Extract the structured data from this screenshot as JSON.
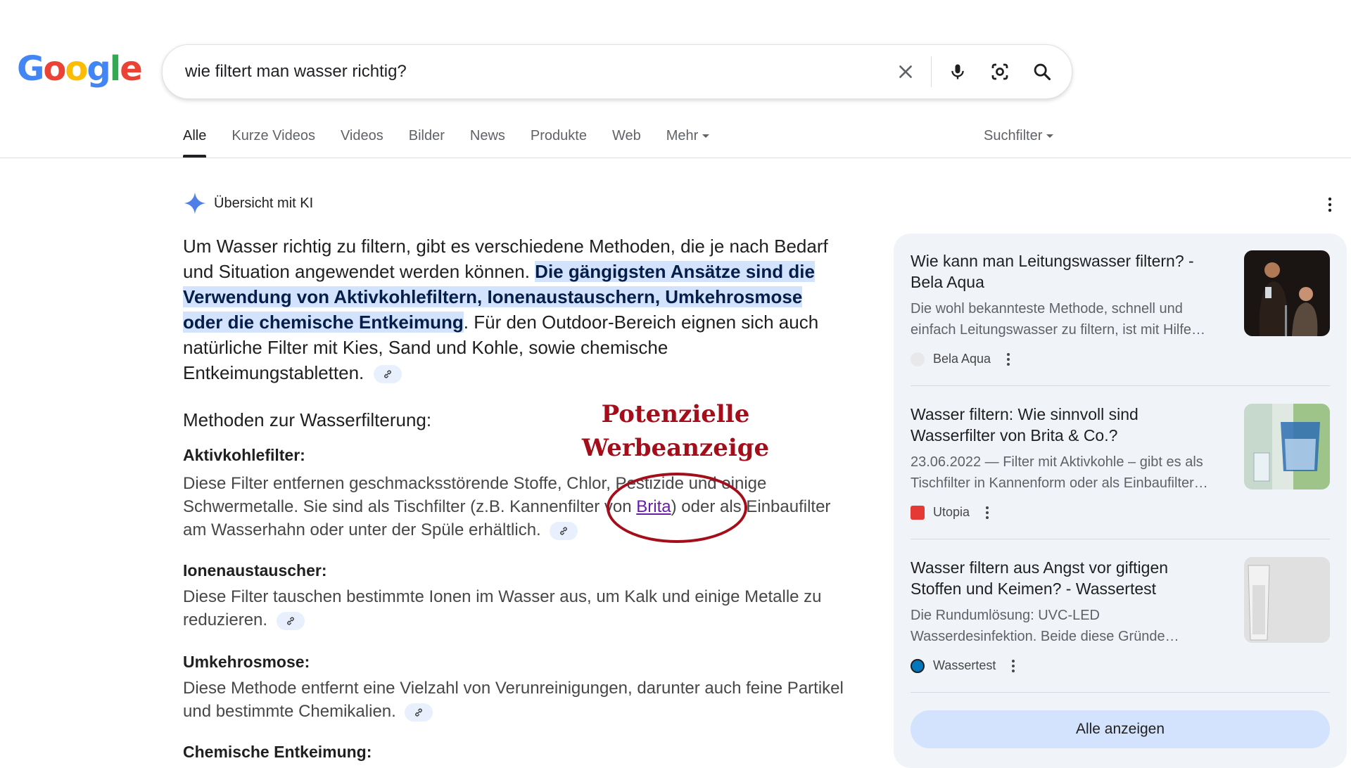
{
  "logo": {
    "letters": [
      "G",
      "o",
      "o",
      "g",
      "l",
      "e"
    ],
    "colors": [
      "#4285F4",
      "#EA4335",
      "#FBBC05",
      "#4285F4",
      "#34A853",
      "#EA4335"
    ]
  },
  "search": {
    "query": "wie filtert man wasser richtig?",
    "icons": [
      "close-icon",
      "mic-icon",
      "lens-icon",
      "search-icon"
    ]
  },
  "tabs": [
    "Alle",
    "Kurze Videos",
    "Videos",
    "Bilder",
    "News",
    "Produkte",
    "Web",
    "Mehr"
  ],
  "suchfilter": "Suchfilter",
  "ai": {
    "title": "Übersicht mit KI",
    "intro_pre": "Um Wasser richtig zu filtern, gibt es verschiedene Methoden, die je nach Bedarf und Situation angewendet werden können. ",
    "intro_highlight": "Die gängigsten Ansätze sind die Verwendung von Aktivkohlefiltern, Ionenaustauschern, Umkehrosmose oder die chemische Entkeimung",
    "intro_post": ". Für den Outdoor-Bereich eignen sich auch natürliche Filter mit Kies, Sand und Kohle, sowie chemische Entkeimungstabletten.",
    "section_heading": "Methoden zur Wasserfilterung:",
    "items": [
      {
        "heading": "Aktivkohlefilter:",
        "text_pre": "Diese Filter entfernen geschmacksstörende Stoffe, Chlor, Pestizide und einige Schwermetalle. Sie sind als Tischfilter (z.B. Kannenfilter von ",
        "link": "Brita",
        "text_post": ") oder als Einbaufilter am Wasserhahn oder unter der Spüle erhältlich."
      },
      {
        "heading": "Ionenaustauscher:",
        "text": "Diese Filter tauschen bestimmte Ionen im Wasser aus, um Kalk und einige Metalle zu reduzieren."
      },
      {
        "heading": "Umkehrosmose:",
        "text": "Diese Methode entfernt eine Vielzahl von Verunreinigungen, darunter auch feine Partikel und bestimmte Chemikalien."
      },
      {
        "heading": "Chemische Entkeimung:"
      }
    ]
  },
  "annotation": {
    "line1": "Potenzielle",
    "line2": "Werbeanzeige",
    "color": "#a40d1a"
  },
  "sources": [
    {
      "title": "Wie kann man Leitungswasser filtern? - Bela Aqua",
      "snippet": "Die wohl bekannteste Methode, schnell und einfach Leitungswasser zu filtern, ist mit Hilfe…",
      "source": "Bela Aqua"
    },
    {
      "title": "Wasser filtern: Wie sinnvoll sind Wasserfilter von Brita & Co.?",
      "snippet": "23.06.2022 — Filter mit Aktivkohle – gibt es als Tischfilter in Kannenform oder als Einbaufilter…",
      "source": "Utopia"
    },
    {
      "title": "Wasser filtern aus Angst vor giftigen Stoffen und Keimen? - Wassertest",
      "snippet": "Die Rundumlösung: UVC-LED Wasserdesinfektion. Beide diese Gründe…",
      "source": "Wassertest"
    }
  ],
  "show_all": "Alle anzeigen"
}
